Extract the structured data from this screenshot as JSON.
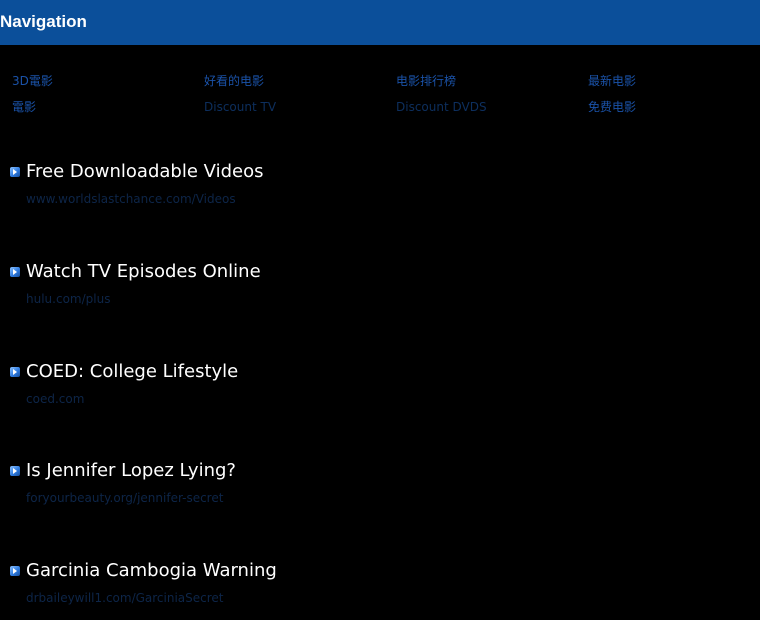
{
  "header": {
    "title": "Navigation",
    "background": "#0b4f9a"
  },
  "nav_links": [
    {
      "label": "3D電影"
    },
    {
      "label": "好看的电影"
    },
    {
      "label": "电影排行榜"
    },
    {
      "label": "最新电影"
    },
    {
      "label": "電影"
    },
    {
      "label": "Discount TV"
    },
    {
      "label": "Discount DVDS"
    },
    {
      "label": "免费电影"
    }
  ],
  "ads": [
    {
      "title": "Free Downloadable Videos",
      "url": "www.worldslastchance.com/Videos"
    },
    {
      "title": "Watch TV Episodes Online",
      "url": "hulu.com/plus"
    },
    {
      "title": "COED: College Lifestyle",
      "url": "coed.com"
    },
    {
      "title": "Is Jennifer Lopez Lying?",
      "url": "foryourbeauty.org/jennifer-secret"
    },
    {
      "title": "Garcinia Cambogia Warning",
      "url": "drbaileywill1.com/GarciniaSecret"
    }
  ],
  "colors": {
    "page_background": "#000000",
    "link_blue": "#1a52a8",
    "ad_title": "#ffffff",
    "ad_url": "#0d2548"
  }
}
